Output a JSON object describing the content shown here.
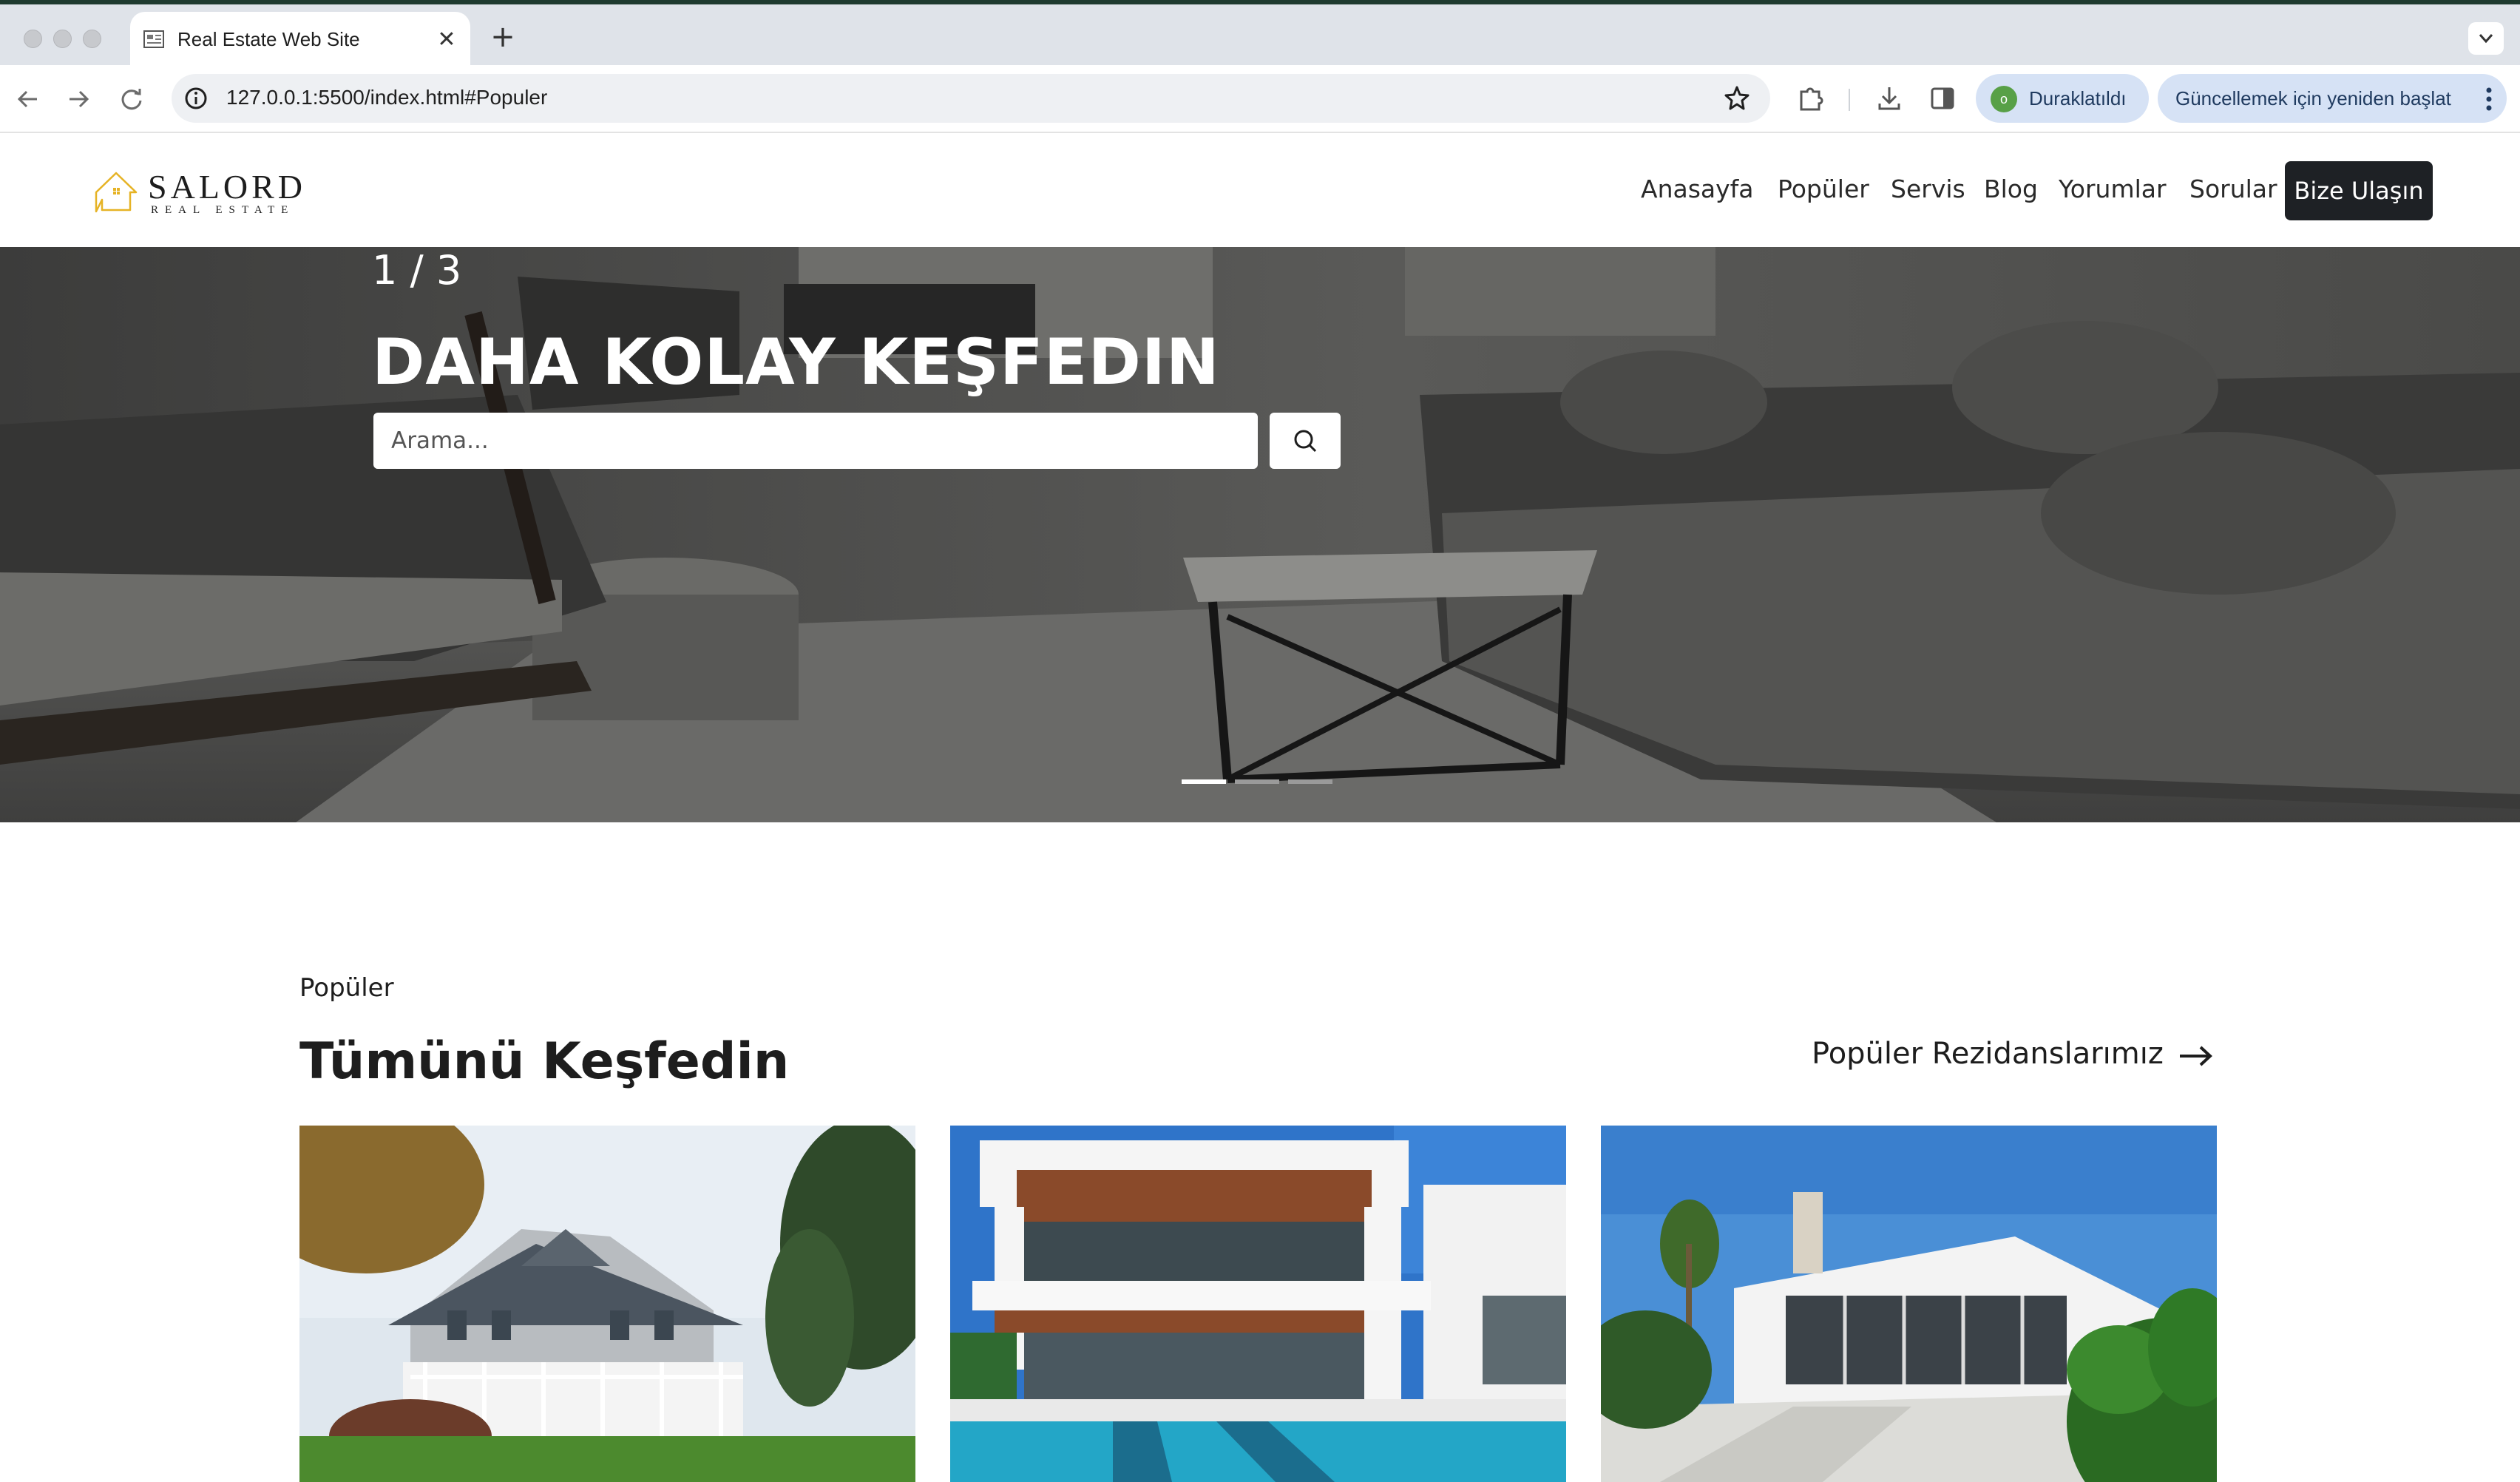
{
  "browser": {
    "tab_title": "Real Estate Web Site",
    "url": "127.0.0.1:5500/index.html#Populer",
    "profile_initial": "o",
    "profile_label": "Duraklatıldı",
    "update_label": "Güncellemek için yeniden başlat"
  },
  "header": {
    "logo_name": "SALORD",
    "logo_sub": "REAL ESTATE",
    "nav": [
      "Anasayfa",
      "Popüler",
      "Servis",
      "Blog",
      "Yorumlar",
      "Sorular"
    ],
    "cta_label": "Bize Ulaşın"
  },
  "hero": {
    "slide_counter": "1 / 3",
    "title": "DAHA KOLAY KEŞFEDIN",
    "search_placeholder": "Arama...",
    "slides_total": 3,
    "active_slide": 1
  },
  "popular": {
    "eyebrow": "Popüler",
    "title": "Tümünü Keşfedin",
    "link_label": "Popüler Rezidanslarımız",
    "cards": [
      "house-card",
      "villa-card",
      "modern-house-card"
    ]
  },
  "colors": {
    "cta_bg": "#1e2125",
    "hero_overlay": "#4a4a49",
    "accent_logo": "#e6b325"
  }
}
